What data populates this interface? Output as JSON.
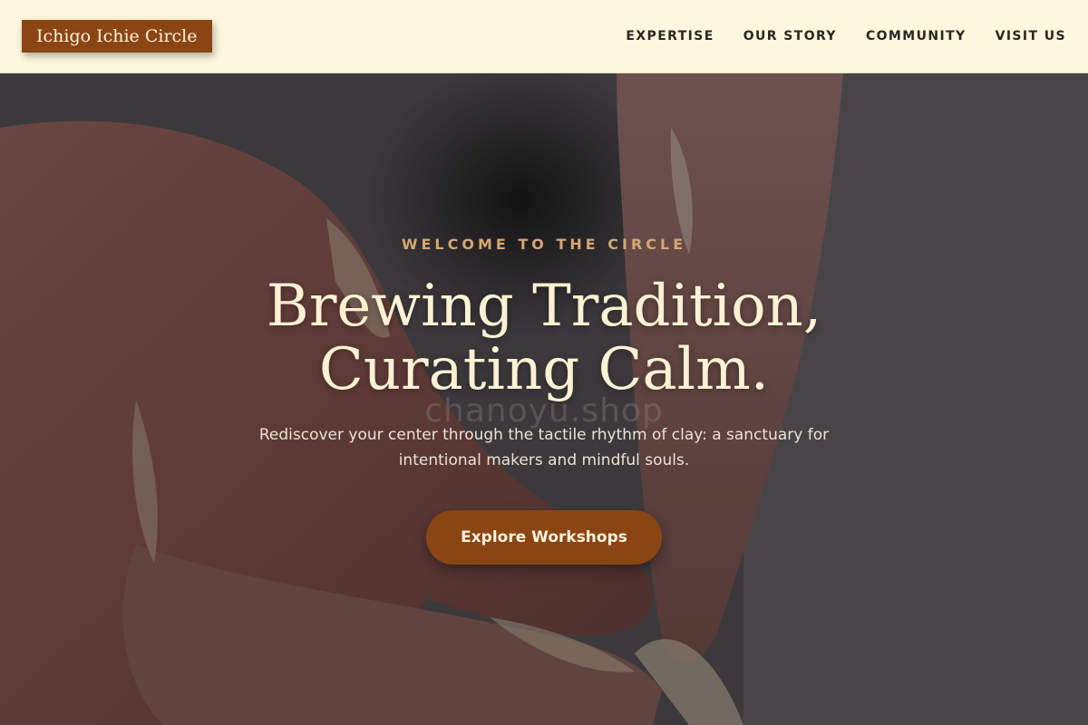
{
  "header": {
    "logo_text": "Ichigo Ichie Circle",
    "nav": [
      {
        "label": "EXPERTISE"
      },
      {
        "label": "OUR STORY"
      },
      {
        "label": "COMMUNITY"
      },
      {
        "label": "VISIT US"
      }
    ]
  },
  "hero": {
    "kicker": "WELCOME TO THE CIRCLE",
    "headline_line1": "Brewing Tradition,",
    "headline_line2": "Curating Calm.",
    "subtitle": "Rediscover your center through the tactile rhythm of clay: a sanctuary for intentional makers and mindful souls.",
    "cta_label": "Explore Workshops",
    "watermark": "chanoyu.shop",
    "background_description_icon": "pottery-hands-image"
  },
  "colors": {
    "header_bg": "#fdf7dd",
    "brand": "#8b4513",
    "kicker": "#d6a674",
    "headline": "#fdf1d4"
  }
}
